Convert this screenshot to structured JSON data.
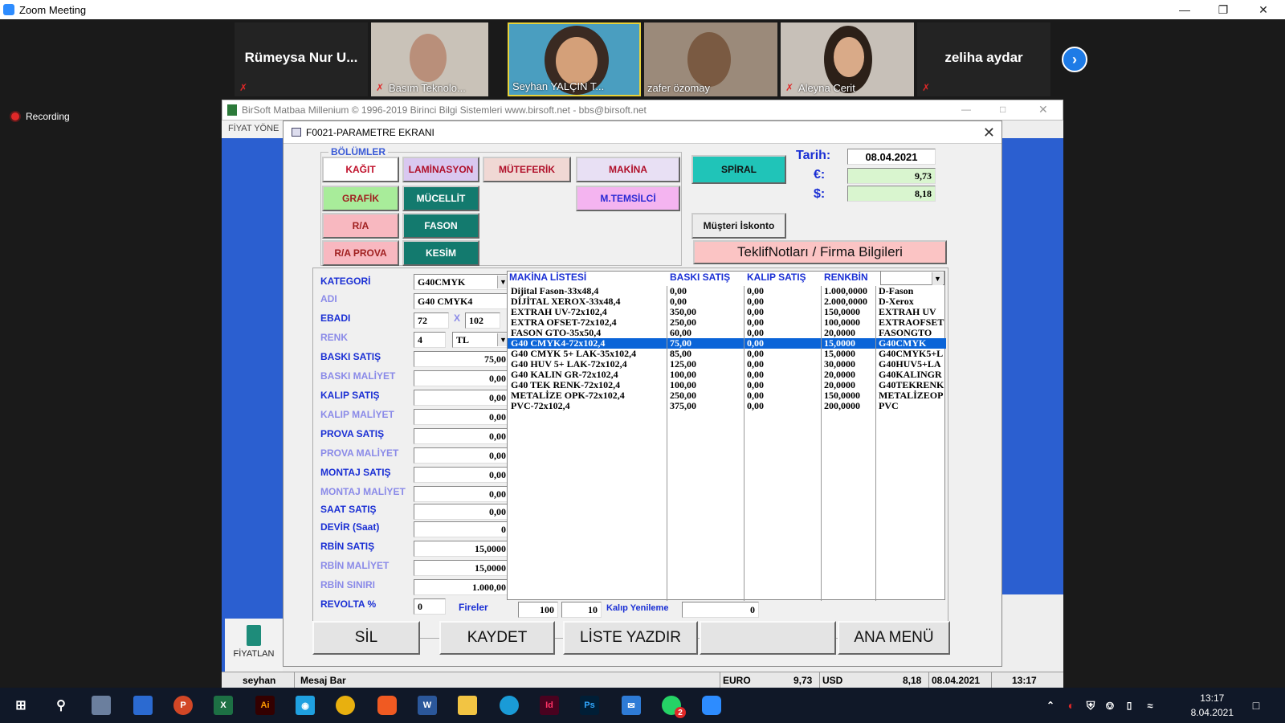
{
  "zoom": {
    "title": "Zoom Meeting",
    "recording": "Recording",
    "participants": [
      "Rümeysa Nur U...",
      "Basım Teknolo...",
      "Seyhan YALÇIN T...",
      "zafer özomay",
      "Aleyna Cerit",
      "zeliha aydar"
    ]
  },
  "birsoft": {
    "title": "BirSoft Matbaa Millenium © 1996-2019   Birinci Bilgi Sistemleri   www.birsoft.net - bbs@birsoft.net",
    "left_tab": "FİYAT YÖNE",
    "fiyat_icon_label": "FİYATLAN",
    "status": {
      "user": "seyhan",
      "mesaj": "Mesaj Bar",
      "euro_label": "EURO",
      "euro": "9,73",
      "usd_label": "USD",
      "usd": "8,18",
      "date": "08.04.2021",
      "time": "13:17"
    }
  },
  "dialog": {
    "title": "F0021-PARAMETRE EKRANI",
    "bolumler": "BÖLÜMLER",
    "buttons": {
      "kagit": "KAĞIT",
      "laminasyon": "LAMİNASYON",
      "muteferik": "MÜTEFERİK",
      "makina": "MAKİNA",
      "grafik": "GRAFİK",
      "mucellit": "MÜCELLİT",
      "mtemsilci": "M.TEMSİLCİ",
      "ra": "R/A",
      "fason": "FASON",
      "raprova": "R/A PROVA",
      "kesim": "KESİM",
      "spiral": "SPİRAL",
      "iskonto": "Müşteri İskonto",
      "teklif": "TeklifNotları / Firma Bilgileri"
    },
    "tarih_label": "Tarih:",
    "tarih": "08.04.2021",
    "euro_label": "€:",
    "euro": "9,73",
    "usd_label": "$:",
    "usd": "8,18",
    "form": {
      "kategori_label": "KATEGORİ",
      "kategori": "G40CMYK",
      "adi_label": "ADI",
      "adi": "G40 CMYK4",
      "ebadi_label": "EBADI",
      "ebadi_w": "72",
      "ebadi_x": "X",
      "ebadi_h": "102",
      "renk_label": "RENK",
      "renk": "4",
      "currency": "TL",
      "baski_satis_label": "BASKI SATIŞ",
      "baski_satis": "75,00",
      "baski_maliyet_label": "BASKI MALİYET",
      "baski_maliyet": "0,00",
      "kalip_satis_label": "KALIP SATIŞ",
      "kalip_satis": "0,00",
      "kalip_maliyet_label": "KALIP MALİYET",
      "kalip_maliyet": "0,00",
      "prova_satis_label": "PROVA SATIŞ",
      "prova_satis": "0,00",
      "prova_maliyet_label": "PROVA MALİYET",
      "prova_maliyet": "0,00",
      "montaj_satis_label": "MONTAJ SATIŞ",
      "montaj_satis": "0,00",
      "montaj_maliyet_label": "MONTAJ MALİYET",
      "montaj_maliyet": "0,00",
      "saat_satis_label": "SAAT SATIŞ",
      "saat_satis": "0,00",
      "devir_label": "DEVİR (Saat)",
      "devir": "0",
      "rbin_satis_label": "RBİN SATIŞ",
      "rbin_satis": "15,0000",
      "rbin_maliyet_label": "RBİN MALİYET",
      "rbin_maliyet": "15,0000",
      "rbin_siniri_label": "RBİN SINIRI",
      "rbin_siniri": "1.000,00",
      "revolta_label": "REVOLTA %",
      "revolta": "0",
      "fireler_label": "Fireler",
      "fire1": "100",
      "fire2": "10",
      "kalip_yenileme_label": "Kalıp Yenileme",
      "kalip_yenileme": "0"
    },
    "list": {
      "headers": [
        "MAKİNA LİSTESİ",
        "BASKI SATIŞ",
        "KALIP SATIŞ",
        "RENKBİN"
      ],
      "selected_index": 5,
      "names": [
        "Dijital Fason-33x48,4",
        "DİJİTAL XEROX-33x48,4",
        "EXTRAH UV-72x102,4",
        "EXTRA OFSET-72x102,4",
        "FASON GTO-35x50,4",
        "G40 CMYK4-72x102,4",
        "G40 CMYK 5+ LAK-35x102,4",
        "G40 HUV 5+ LAK-72x102,4",
        "G40 KALIN GR-72x102,4",
        "G40 TEK RENK-72x102,4",
        "METALİZE OPK-72x102,4",
        "PVC-72x102,4"
      ],
      "baski": [
        "0,00",
        "0,00",
        "350,00",
        "250,00",
        "60,00",
        "75,00",
        "85,00",
        "125,00",
        "100,00",
        "100,00",
        "250,00",
        "375,00"
      ],
      "kalip": [
        "0,00",
        "0,00",
        "0,00",
        "0,00",
        "0,00",
        "0,00",
        "0,00",
        "0,00",
        "0,00",
        "0,00",
        "0,00",
        "0,00"
      ],
      "renkbin": [
        "1.000,0000",
        "2.000,0000",
        "150,0000",
        "100,0000",
        "20,0000",
        "15,0000",
        "15,0000",
        "30,0000",
        "20,0000",
        "20,0000",
        "150,0000",
        "200,0000"
      ],
      "codes": [
        "D-Fason",
        "D-Xerox",
        "EXTRAH UV",
        "EXTRAOFSET",
        "FASONGTO",
        "G40CMYK",
        "G40CMYK5+L",
        "G40HUV5+LA",
        "G40KALINGR",
        "G40TEKRENK",
        "METALİZEOP",
        "PVC"
      ]
    },
    "bottom": {
      "sil": "SİL",
      "kaydet": "KAYDET",
      "liste": "LİSTE YAZDIR",
      "ana": "ANA MENÜ"
    }
  },
  "taskbar": {
    "time": "13:17",
    "date": "8.04.2021",
    "badge": "2"
  }
}
